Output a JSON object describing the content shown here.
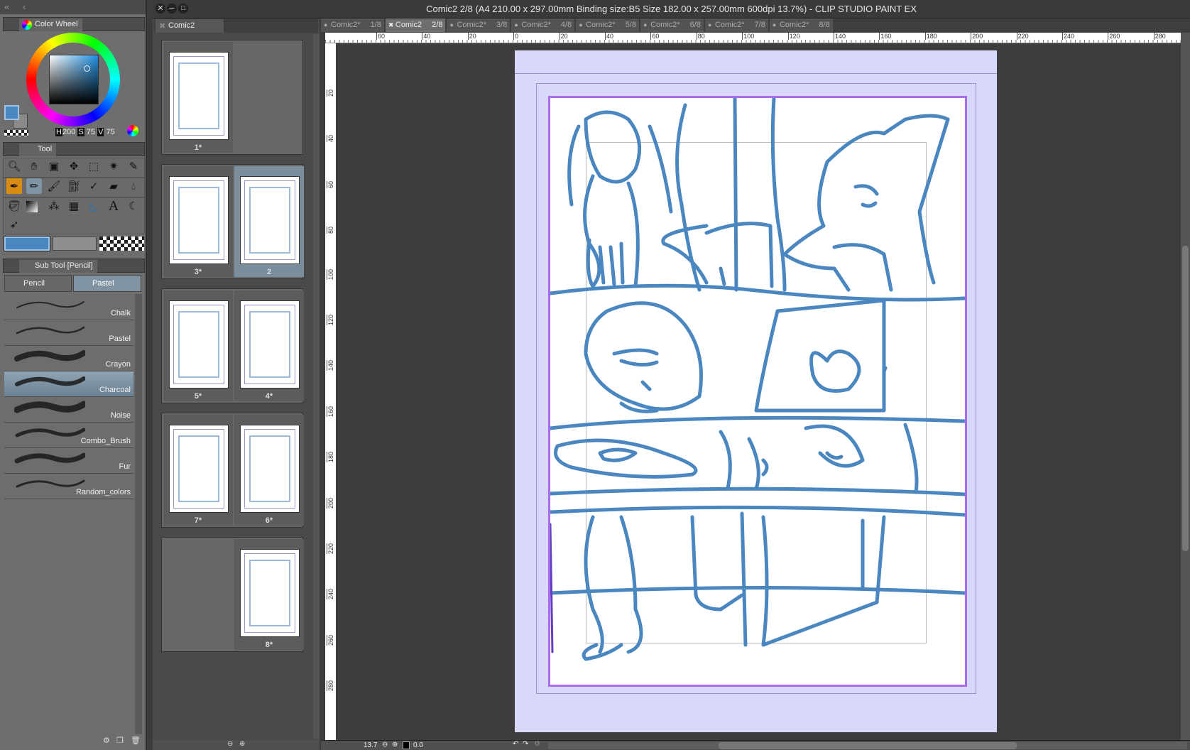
{
  "left_panel": {
    "color_wheel_tab": "Color Wheel",
    "hsv": {
      "h_label": "H",
      "h": "200",
      "s_label": "S",
      "s": "75",
      "v_label": "V",
      "v": "75"
    },
    "main_color": "#4a86c0",
    "sub_color": "#8a8a8a",
    "tool_tab": "Tool",
    "subtool_tab": "Sub Tool [Pencil]",
    "subtool_groups": [
      "Pencil",
      "Pastel"
    ],
    "brushes": [
      "Chalk",
      "Pastel",
      "Crayon",
      "Charcoal",
      "Noise",
      "Combo_Brush",
      "Fur",
      "Random_colors"
    ],
    "selected_brush": "Charcoal"
  },
  "thumbs": {
    "tab": "Comic2",
    "pages": [
      {
        "group": 0,
        "cell": 0,
        "label": "1*"
      },
      {
        "group": 1,
        "cell": 0,
        "label": "3*"
      },
      {
        "group": 1,
        "cell": 1,
        "label": "2",
        "selected": true
      },
      {
        "group": 2,
        "cell": 0,
        "label": "5*"
      },
      {
        "group": 2,
        "cell": 1,
        "label": "4*"
      },
      {
        "group": 3,
        "cell": 0,
        "label": "7*"
      },
      {
        "group": 3,
        "cell": 1,
        "label": "6*"
      },
      {
        "group": 4,
        "cell": 1,
        "label": "8*"
      }
    ]
  },
  "window": {
    "title": "Comic2 2/8 (A4 210.00 x 297.00mm Binding size:B5 Size 182.00 x 257.00mm 600dpi 13.7%)  - CLIP STUDIO PAINT EX"
  },
  "doc_tabs": [
    {
      "name": "Comic2*",
      "page": "1/8"
    },
    {
      "name": "Comic2",
      "page": "2/8",
      "active": true
    },
    {
      "name": "Comic2*",
      "page": "3/8"
    },
    {
      "name": "Comic2*",
      "page": "4/8"
    },
    {
      "name": "Comic2*",
      "page": "5/8"
    },
    {
      "name": "Comic2*",
      "page": "6/8"
    },
    {
      "name": "Comic2*",
      "page": "7/8"
    },
    {
      "name": "Comic2*",
      "page": "8/8"
    }
  ],
  "rulers": {
    "h": [
      "60",
      "40",
      "20",
      "0",
      "20",
      "40",
      "60",
      "80",
      "100",
      "120",
      "140",
      "160",
      "180",
      "200",
      "220",
      "240",
      "260",
      "280"
    ],
    "v": [
      "20",
      "40",
      "60",
      "80",
      "100",
      "120",
      "140",
      "160",
      "180",
      "200",
      "220",
      "240",
      "260",
      "280"
    ]
  },
  "status": {
    "zoom": "13.7",
    "rotation": "0.0"
  },
  "colors": {
    "sketch": "#4a86c0",
    "page_bg": "#d8d8fb",
    "frame": "#a96cf0"
  }
}
